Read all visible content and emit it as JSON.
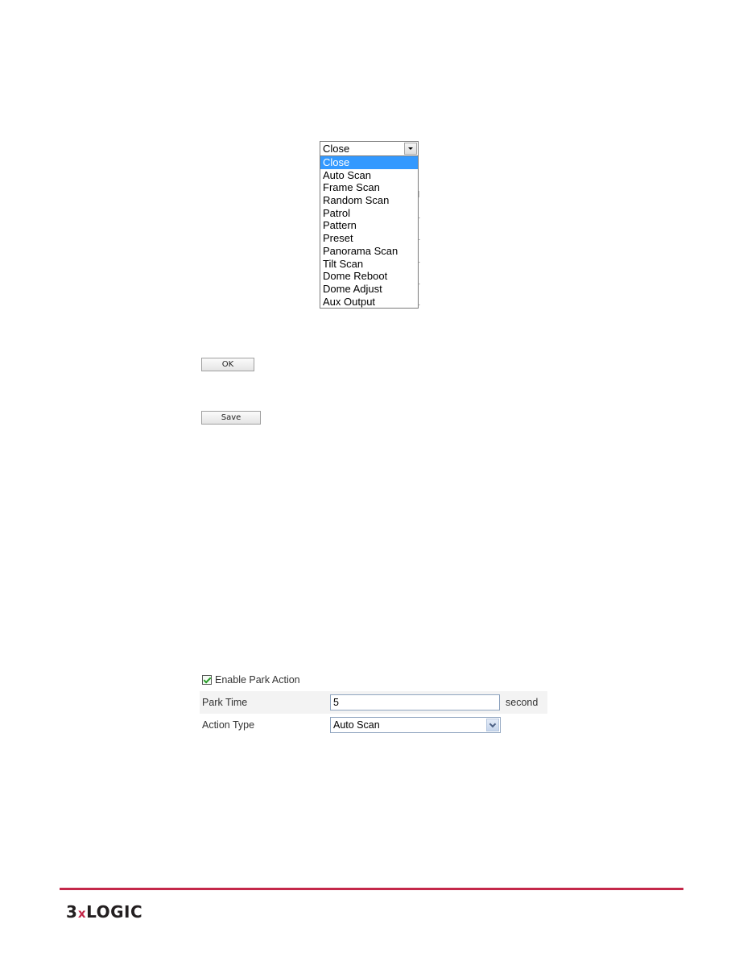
{
  "figure_dropdown": {
    "current_value": "Close",
    "options": [
      "Close",
      "Auto Scan",
      "Frame Scan",
      "Random Scan",
      "Patrol",
      "Pattern",
      "Preset",
      "Panorama Scan",
      "Tilt Scan",
      "Dome Reboot",
      "Dome Adjust",
      "Aux Output"
    ],
    "selected_index": 0,
    "highlight_color": "#3399ff"
  },
  "buttons": {
    "ok_label": "OK",
    "save_label": "Save"
  },
  "park_form": {
    "enable_label": "Enable Park Action",
    "enable_checked": true,
    "park_time_label": "Park Time",
    "park_time_value": "5",
    "park_time_unit": "second",
    "action_type_label": "Action Type",
    "action_type_value": "Auto Scan"
  },
  "footer": {
    "logo_part1": "3",
    "logo_x": "x",
    "logo_part2": "LOGIC",
    "brand_color": "#c4284a"
  }
}
